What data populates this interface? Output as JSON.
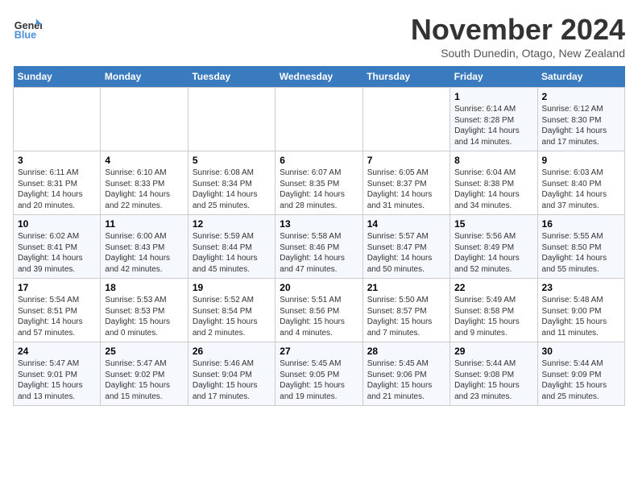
{
  "header": {
    "logo_line1": "General",
    "logo_line2": "Blue",
    "month_title": "November 2024",
    "subtitle": "South Dunedin, Otago, New Zealand"
  },
  "days_of_week": [
    "Sunday",
    "Monday",
    "Tuesday",
    "Wednesday",
    "Thursday",
    "Friday",
    "Saturday"
  ],
  "weeks": [
    [
      {
        "day": "",
        "info": ""
      },
      {
        "day": "",
        "info": ""
      },
      {
        "day": "",
        "info": ""
      },
      {
        "day": "",
        "info": ""
      },
      {
        "day": "",
        "info": ""
      },
      {
        "day": "1",
        "info": "Sunrise: 6:14 AM\nSunset: 8:28 PM\nDaylight: 14 hours and 14 minutes."
      },
      {
        "day": "2",
        "info": "Sunrise: 6:12 AM\nSunset: 8:30 PM\nDaylight: 14 hours and 17 minutes."
      }
    ],
    [
      {
        "day": "3",
        "info": "Sunrise: 6:11 AM\nSunset: 8:31 PM\nDaylight: 14 hours and 20 minutes."
      },
      {
        "day": "4",
        "info": "Sunrise: 6:10 AM\nSunset: 8:33 PM\nDaylight: 14 hours and 22 minutes."
      },
      {
        "day": "5",
        "info": "Sunrise: 6:08 AM\nSunset: 8:34 PM\nDaylight: 14 hours and 25 minutes."
      },
      {
        "day": "6",
        "info": "Sunrise: 6:07 AM\nSunset: 8:35 PM\nDaylight: 14 hours and 28 minutes."
      },
      {
        "day": "7",
        "info": "Sunrise: 6:05 AM\nSunset: 8:37 PM\nDaylight: 14 hours and 31 minutes."
      },
      {
        "day": "8",
        "info": "Sunrise: 6:04 AM\nSunset: 8:38 PM\nDaylight: 14 hours and 34 minutes."
      },
      {
        "day": "9",
        "info": "Sunrise: 6:03 AM\nSunset: 8:40 PM\nDaylight: 14 hours and 37 minutes."
      }
    ],
    [
      {
        "day": "10",
        "info": "Sunrise: 6:02 AM\nSunset: 8:41 PM\nDaylight: 14 hours and 39 minutes."
      },
      {
        "day": "11",
        "info": "Sunrise: 6:00 AM\nSunset: 8:43 PM\nDaylight: 14 hours and 42 minutes."
      },
      {
        "day": "12",
        "info": "Sunrise: 5:59 AM\nSunset: 8:44 PM\nDaylight: 14 hours and 45 minutes."
      },
      {
        "day": "13",
        "info": "Sunrise: 5:58 AM\nSunset: 8:46 PM\nDaylight: 14 hours and 47 minutes."
      },
      {
        "day": "14",
        "info": "Sunrise: 5:57 AM\nSunset: 8:47 PM\nDaylight: 14 hours and 50 minutes."
      },
      {
        "day": "15",
        "info": "Sunrise: 5:56 AM\nSunset: 8:49 PM\nDaylight: 14 hours and 52 minutes."
      },
      {
        "day": "16",
        "info": "Sunrise: 5:55 AM\nSunset: 8:50 PM\nDaylight: 14 hours and 55 minutes."
      }
    ],
    [
      {
        "day": "17",
        "info": "Sunrise: 5:54 AM\nSunset: 8:51 PM\nDaylight: 14 hours and 57 minutes."
      },
      {
        "day": "18",
        "info": "Sunrise: 5:53 AM\nSunset: 8:53 PM\nDaylight: 15 hours and 0 minutes."
      },
      {
        "day": "19",
        "info": "Sunrise: 5:52 AM\nSunset: 8:54 PM\nDaylight: 15 hours and 2 minutes."
      },
      {
        "day": "20",
        "info": "Sunrise: 5:51 AM\nSunset: 8:56 PM\nDaylight: 15 hours and 4 minutes."
      },
      {
        "day": "21",
        "info": "Sunrise: 5:50 AM\nSunset: 8:57 PM\nDaylight: 15 hours and 7 minutes."
      },
      {
        "day": "22",
        "info": "Sunrise: 5:49 AM\nSunset: 8:58 PM\nDaylight: 15 hours and 9 minutes."
      },
      {
        "day": "23",
        "info": "Sunrise: 5:48 AM\nSunset: 9:00 PM\nDaylight: 15 hours and 11 minutes."
      }
    ],
    [
      {
        "day": "24",
        "info": "Sunrise: 5:47 AM\nSunset: 9:01 PM\nDaylight: 15 hours and 13 minutes."
      },
      {
        "day": "25",
        "info": "Sunrise: 5:47 AM\nSunset: 9:02 PM\nDaylight: 15 hours and 15 minutes."
      },
      {
        "day": "26",
        "info": "Sunrise: 5:46 AM\nSunset: 9:04 PM\nDaylight: 15 hours and 17 minutes."
      },
      {
        "day": "27",
        "info": "Sunrise: 5:45 AM\nSunset: 9:05 PM\nDaylight: 15 hours and 19 minutes."
      },
      {
        "day": "28",
        "info": "Sunrise: 5:45 AM\nSunset: 9:06 PM\nDaylight: 15 hours and 21 minutes."
      },
      {
        "day": "29",
        "info": "Sunrise: 5:44 AM\nSunset: 9:08 PM\nDaylight: 15 hours and 23 minutes."
      },
      {
        "day": "30",
        "info": "Sunrise: 5:44 AM\nSunset: 9:09 PM\nDaylight: 15 hours and 25 minutes."
      }
    ]
  ]
}
